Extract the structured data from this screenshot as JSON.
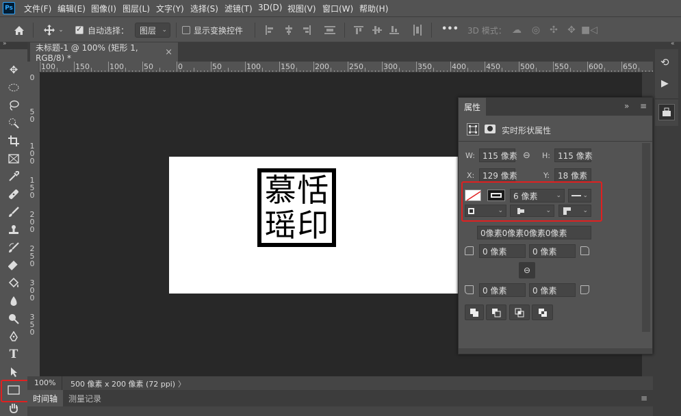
{
  "app": {
    "logo": "Ps"
  },
  "menu": [
    "文件(F)",
    "编辑(E)",
    "图像(I)",
    "图层(L)",
    "文字(Y)",
    "选择(S)",
    "滤镜(T)",
    "3D(D)",
    "视图(V)",
    "窗口(W)",
    "帮助(H)"
  ],
  "options": {
    "auto_select_label": "自动选择：",
    "auto_select_checked": true,
    "target_value": "图层",
    "show_transform_label": "显示变换控件",
    "show_transform_checked": false,
    "mode3d_label": "3D 模式：",
    "more": "•••"
  },
  "document": {
    "tab_title": "未标题-1 @ 100% (矩形 1, RGB/8) *",
    "close": "×"
  },
  "ruler": {
    "h_labels": [
      "100",
      "150",
      "100",
      "50",
      "0",
      "50",
      "100",
      "150",
      "200",
      "250",
      "300",
      "350",
      "400",
      "450",
      "500",
      "550",
      "600",
      "650"
    ],
    "v_labels": [
      "0",
      "5\n0",
      "1\n0\n0",
      "1\n5\n0",
      "2\n0\n0",
      "2\n5\n0",
      "3\n0\n0",
      "3\n5\n0"
    ]
  },
  "canvas": {
    "seal_chars": [
      "慕",
      "恬",
      "瑶",
      "印"
    ]
  },
  "status": {
    "zoom": "100%",
    "doc_size": "500 像素 x 200 像素 (72 ppi)",
    "arrow": "〉"
  },
  "bottom_panel": {
    "tabs": [
      "时间轴",
      "测量记录"
    ]
  },
  "properties": {
    "tab": "属性",
    "section_title": "实时形状属性",
    "w_label": "W:",
    "w_value": "115 像素",
    "h_label": "H:",
    "h_value": "115 像素",
    "x_label": "X:",
    "x_value": "129 像素",
    "y_label": "Y:",
    "y_value": "18 像素",
    "stroke_width": "6 像素",
    "corner_all": "0像素0像素0像素0像素",
    "corner_tl": "0 像素",
    "corner_tr": "0 像素",
    "corner_bl": "0 像素",
    "corner_br": "0 像素"
  },
  "colors": {
    "highlight": "#e02020",
    "panel_bg": "#535353",
    "canvas_bg": "#282828"
  }
}
